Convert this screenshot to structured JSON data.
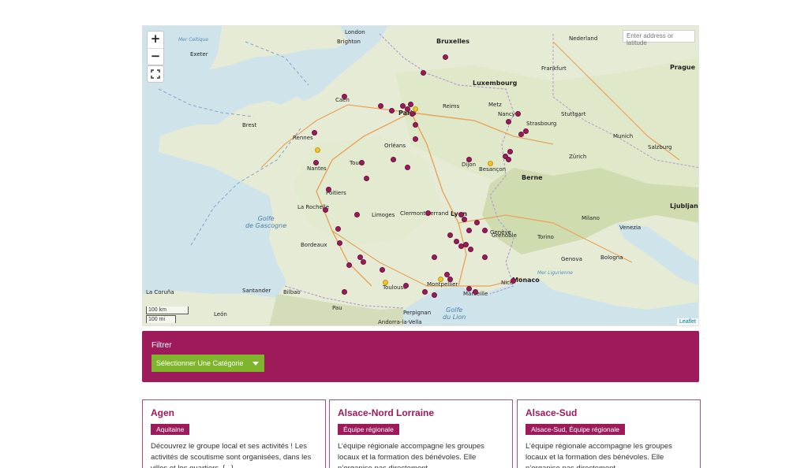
{
  "map": {
    "zoom_in": "+",
    "zoom_out": "−",
    "search_placeholder": "Enter address or latitude",
    "scale_km": "100 km",
    "scale_mi": "100 mi",
    "attribution": "Leaflet",
    "labels": {
      "pays_bas": "Nederland",
      "bruxelles": "Bruxelles",
      "luxembourg": "Luxembourg",
      "frankfurt": "Frankfurt",
      "prague": "Prague",
      "paris": "Paris",
      "caen": "Caen",
      "rennes": "Rennes",
      "nantes": "Nantes",
      "tours": "Tours",
      "orleans": "Orléans",
      "dijon": "Dijon",
      "besancon": "Besançon",
      "strasbourg": "Strasbourg",
      "bern": "Berne",
      "lyon": "Lyon",
      "limoges": "Limoges",
      "clermont": "Clermont-Ferrand",
      "grenoble": "Grenoble",
      "bordeaux": "Bordeaux",
      "toulouse": "Toulouse",
      "montpellier": "Montpellier",
      "marseille": "Marseille",
      "monaco": "Monaco",
      "genova": "Genova",
      "milano": "Milano",
      "ljubljana": "Ljubljana",
      "munich": "Munich",
      "andorra": "Andorra-la-Vella",
      "golfe_gascogne": "Golfe\nde Gascogne",
      "golfe_lion": "Golfe\ndu Lion",
      "mer_celtique": "Mer Celtique",
      "brest": "Brest",
      "poitiers": "Poitiers",
      "la_rochelle": "La Rochelle",
      "reims": "Reims",
      "metz": "Metz",
      "nancy": "Nancy",
      "zurich": "Zürich",
      "geneve": "Genève",
      "torino": "Torino",
      "nice": "Nice",
      "perpignan": "Perpignan",
      "pau": "Pau",
      "bilbao": "Bilbao",
      "santander": "Santander",
      "la_coruna": "La Coruña",
      "leon": "León",
      "brighton": "Brighton",
      "london": "London",
      "exeter": "Exeter",
      "venezia": "Venezia",
      "bologna": "Bologna",
      "salzburg": "Salzburg",
      "stuttgart": "Stuttgart",
      "mer_ligurienne": "Mer Ligurienne"
    }
  },
  "filter": {
    "title": "Filtrer",
    "select_label": "Sélectionner Une Catégorie"
  },
  "cards": [
    {
      "title": "Agen",
      "tag": "Aquitaine",
      "text": "Découvrez le groupe local et ses activités ! Les activités de scoutisme sont organisées, dans les villes et les quartiers, [...]"
    },
    {
      "title": "Alsace-Nord Lorraine",
      "tag": "Équipe régionale",
      "text": "L’équipe régionale accompagne les groupes locaux et la formation des bénévoles. Elle n’organise pas directement"
    },
    {
      "title": "Alsace-Sud",
      "tag": "Alsace-Sud, Équipe régionale",
      "text": "L’équipe régionale accompagne les groupes locaux et la formation des bénévoles. Elle n’organise pas directement"
    }
  ],
  "colors": {
    "brand": "#9d1a5b",
    "select_green": "#7fb52b",
    "marker_purple": "#9a1b5a",
    "marker_yellow": "#f2c42c",
    "sea": "#cfe3ea",
    "land": "#e8ecd8"
  }
}
